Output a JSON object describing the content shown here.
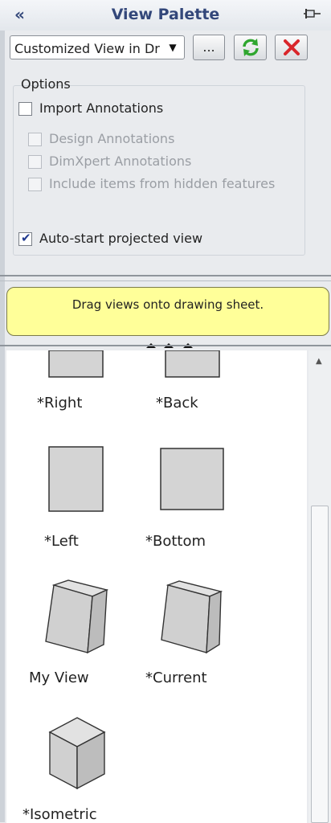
{
  "panel": {
    "collapse_glyph": "«",
    "title": "View Palette",
    "pin_icon": "pushpin-icon"
  },
  "toolbar": {
    "document_select": "Customized View in Dr",
    "more_button_label": "...",
    "refresh_icon": "refresh-icon",
    "close_icon": "close-icon"
  },
  "options": {
    "group_label": "Options",
    "import_annotations": {
      "label": "Import Annotations",
      "checked": false,
      "enabled": true
    },
    "design_annotations": {
      "label": "Design Annotations",
      "checked": false,
      "enabled": false
    },
    "dimxpert_annotations": {
      "label": "DimXpert Annotations",
      "checked": false,
      "enabled": false
    },
    "hidden_features": {
      "label": "Include items from hidden features",
      "checked": false,
      "enabled": false
    },
    "auto_start": {
      "label": "Auto-start projected view",
      "checked": true,
      "enabled": true
    }
  },
  "hint": "Drag views onto drawing sheet.",
  "views": [
    {
      "label": "*Right",
      "icon": "right-view-icon"
    },
    {
      "label": "*Back",
      "icon": "back-view-icon"
    },
    {
      "label": "*Left",
      "icon": "left-view-icon"
    },
    {
      "label": "*Bottom",
      "icon": "bottom-view-icon"
    },
    {
      "label": "My View",
      "icon": "my-view-icon"
    },
    {
      "label": "*Current",
      "icon": "current-view-icon"
    },
    {
      "label": "*Isometric",
      "icon": "isometric-view-icon"
    }
  ],
  "colors": {
    "title_text": "#33477a",
    "hint_background": "#ffff99",
    "refresh_green": "#2fa62f",
    "close_red": "#d9262b",
    "view_gray": "#d4d4d4"
  }
}
